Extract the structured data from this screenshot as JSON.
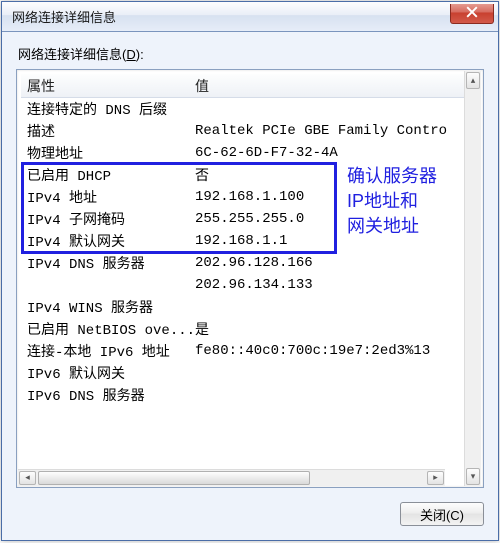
{
  "title": "网络连接详细信息",
  "section_label_prefix": "网络连接详细信息(",
  "section_label_hotkey": "D",
  "section_label_suffix": "):",
  "columns": {
    "prop": "属性",
    "val": "值"
  },
  "rows": [
    {
      "prop": "连接特定的 DNS 后缀",
      "val": ""
    },
    {
      "prop": "描述",
      "val": "Realtek PCIe GBE Family Contro"
    },
    {
      "prop": "物理地址",
      "val": "6C-62-6D-F7-32-4A"
    },
    {
      "prop": "已启用 DHCP",
      "val": "否"
    },
    {
      "prop": "IPv4 地址",
      "val": "192.168.1.100"
    },
    {
      "prop": "IPv4 子网掩码",
      "val": "255.255.255.0"
    },
    {
      "prop": "IPv4 默认网关",
      "val": "192.168.1.1"
    },
    {
      "prop": "IPv4 DNS 服务器",
      "val": "202.96.128.166"
    },
    {
      "prop": "",
      "val": "202.96.134.133"
    },
    {
      "prop": "IPv4 WINS 服务器",
      "val": ""
    },
    {
      "prop": "已启用 NetBIOS ove...",
      "val": "是"
    },
    {
      "prop": "连接-本地 IPv6 地址",
      "val": "fe80::40c0:700c:19e7:2ed3%13"
    },
    {
      "prop": "IPv6 默认网关",
      "val": ""
    },
    {
      "prop": "IPv6 DNS 服务器",
      "val": ""
    }
  ],
  "annotation": {
    "line1": "确认服务器",
    "line2": "IP地址和",
    "line3": "网关地址"
  },
  "close_button_label": "关闭(C)"
}
